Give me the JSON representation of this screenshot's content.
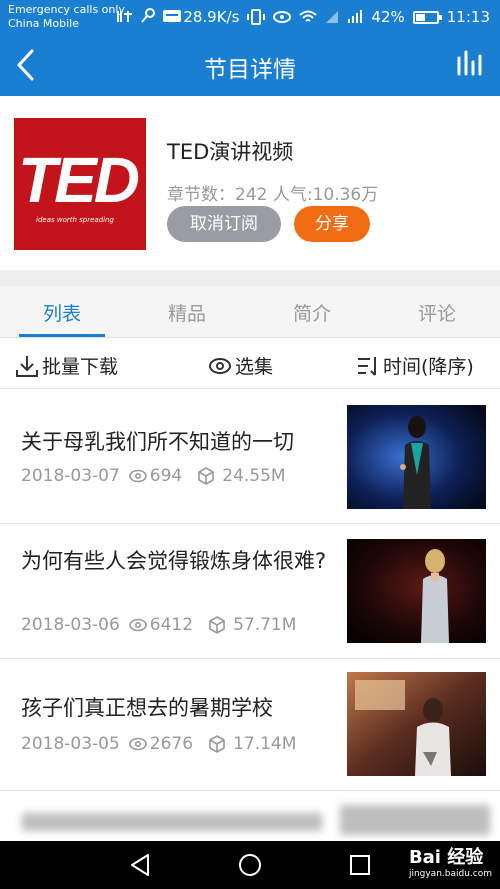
{
  "status_bar": {
    "carrier_line1": "Emergency calls only",
    "carrier_line2": "China Mobile",
    "net_speed": "28.9K/s",
    "battery": "42%",
    "battery_level": 0.42,
    "time": "11:13"
  },
  "header": {
    "title": "节目详情"
  },
  "program": {
    "logo_text": "TED",
    "logo_tagline": "ideas worth spreading",
    "title": "TED演讲视频",
    "meta": "章节数：242  人气:10.36万",
    "unsubscribe_label": "取消订阅",
    "share_label": "分享"
  },
  "tabs": [
    {
      "label": "列表",
      "active": true
    },
    {
      "label": "精品",
      "active": false
    },
    {
      "label": "简介",
      "active": false
    },
    {
      "label": "评论",
      "active": false
    }
  ],
  "toolbar": {
    "batch_download": "批量下载",
    "select": "选集",
    "sort": "时间(降序)"
  },
  "episodes": [
    {
      "title": "关于母乳我们所不知道的一切",
      "date": "2018-03-07",
      "views": "694",
      "size": "24.55M"
    },
    {
      "title": "为何有些人会觉得锻炼身体很难?",
      "date": "2018-03-06",
      "views": "6412",
      "size": "57.71M"
    },
    {
      "title": "孩子们真正想去的暑期学校",
      "date": "2018-03-05",
      "views": "2676",
      "size": "17.14M"
    }
  ],
  "watermark": {
    "brand": "Bai 经验",
    "url": "jingyan.baidu.com"
  },
  "colors": {
    "primary": "#1a7fd0",
    "accent_orange": "#f06d14",
    "muted_button": "#999da3",
    "ted_red": "#c4141b"
  }
}
